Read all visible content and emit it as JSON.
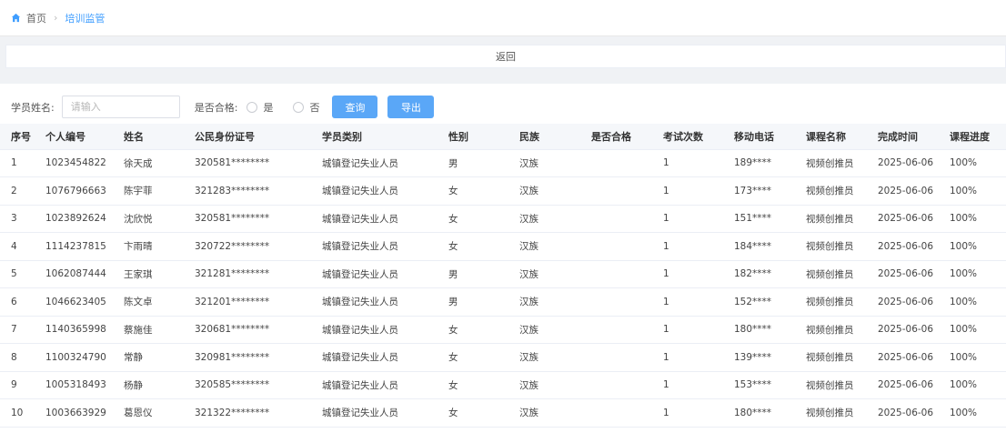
{
  "breadcrumb": {
    "home": "首页",
    "current": "培训监管"
  },
  "back": {
    "label": "返回"
  },
  "filters": {
    "name_label": "学员姓名:",
    "name_placeholder": "请输入",
    "pass_label": "是否合格:",
    "option_yes": "是",
    "option_no": "否",
    "search_button": "查询",
    "export_button": "导出"
  },
  "colors": {
    "accent": "#409eff",
    "button": "#5aa7f7"
  },
  "table": {
    "columns": [
      "序号",
      "个人编号",
      "姓名",
      "公民身份证号",
      "学员类别",
      "性别",
      "民族",
      "是否合格",
      "考试次数",
      "移动电话",
      "课程名称",
      "完成时间",
      "课程进度"
    ],
    "rows": [
      [
        "1",
        "1023454822",
        "徐天成",
        "320581********",
        "城镇登记失业人员",
        "男",
        "汉族",
        "",
        "1",
        "189****",
        "视频创推员",
        "2025-06-06",
        "100%"
      ],
      [
        "2",
        "1076796663",
        "陈宇菲",
        "321283********",
        "城镇登记失业人员",
        "女",
        "汉族",
        "",
        "1",
        "173****",
        "视频创推员",
        "2025-06-06",
        "100%"
      ],
      [
        "3",
        "1023892624",
        "沈欣悦",
        "320581********",
        "城镇登记失业人员",
        "女",
        "汉族",
        "",
        "1",
        "151****",
        "视频创推员",
        "2025-06-06",
        "100%"
      ],
      [
        "4",
        "1114237815",
        "卞雨晴",
        "320722********",
        "城镇登记失业人员",
        "女",
        "汉族",
        "",
        "1",
        "184****",
        "视频创推员",
        "2025-06-06",
        "100%"
      ],
      [
        "5",
        "1062087444",
        "王家琪",
        "321281********",
        "城镇登记失业人员",
        "男",
        "汉族",
        "",
        "1",
        "182****",
        "视频创推员",
        "2025-06-06",
        "100%"
      ],
      [
        "6",
        "1046623405",
        "陈文卓",
        "321201********",
        "城镇登记失业人员",
        "男",
        "汉族",
        "",
        "1",
        "152****",
        "视频创推员",
        "2025-06-06",
        "100%"
      ],
      [
        "7",
        "1140365998",
        "蔡施佳",
        "320681********",
        "城镇登记失业人员",
        "女",
        "汉族",
        "",
        "1",
        "180****",
        "视频创推员",
        "2025-06-06",
        "100%"
      ],
      [
        "8",
        "1100324790",
        "常静",
        "320981********",
        "城镇登记失业人员",
        "女",
        "汉族",
        "",
        "1",
        "139****",
        "视频创推员",
        "2025-06-06",
        "100%"
      ],
      [
        "9",
        "1005318493",
        "杨静",
        "320585********",
        "城镇登记失业人员",
        "女",
        "汉族",
        "",
        "1",
        "153****",
        "视频创推员",
        "2025-06-06",
        "100%"
      ],
      [
        "10",
        "1003663929",
        "葛恩仪",
        "321322********",
        "城镇登记失业人员",
        "女",
        "汉族",
        "",
        "1",
        "180****",
        "视频创推员",
        "2025-06-06",
        "100%"
      ]
    ]
  }
}
